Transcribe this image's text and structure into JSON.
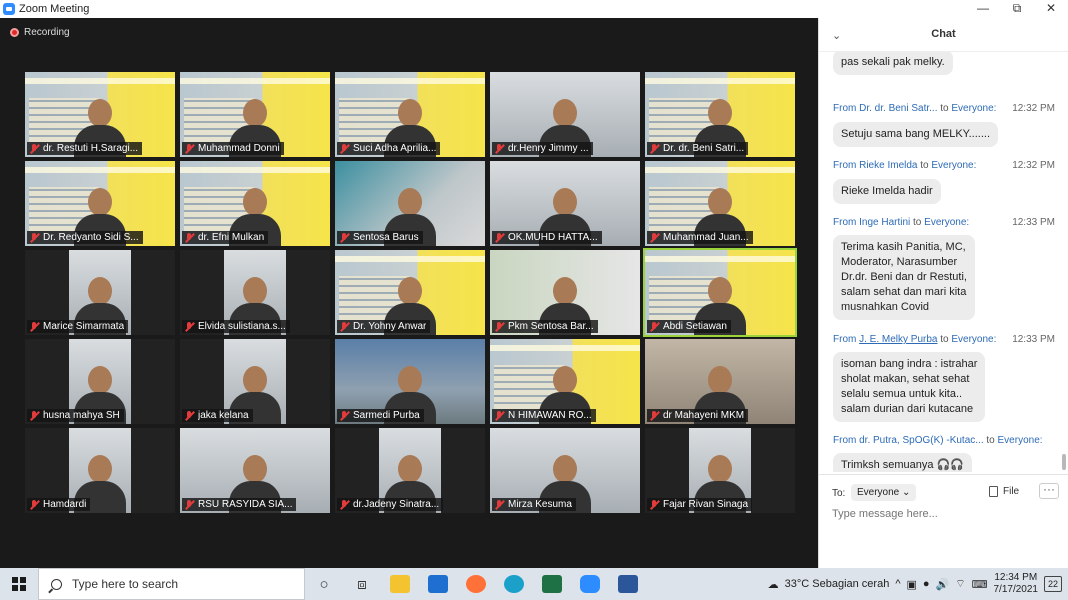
{
  "window": {
    "title": "Zoom Meeting",
    "minimize": "—",
    "maximize": "⧉",
    "close": "✕"
  },
  "recording": {
    "label": "Recording"
  },
  "colors": {
    "accent": "#2d8cff",
    "recording": "#e02828",
    "chat_name": "#2d6bb5",
    "active_speaker": "#9ad33a"
  },
  "participants": [
    {
      "name": "dr. Restuti H.Saragi..."
    },
    {
      "name": "Muhammad Donni"
    },
    {
      "name": "Suci Adha Aprilia..."
    },
    {
      "name": "dr.Henry Jimmy ..."
    },
    {
      "name": "Dr. dr. Beni Satri..."
    },
    {
      "name": "Dr. Redyanto Sidi S..."
    },
    {
      "name": "dr. Efni Mulkan"
    },
    {
      "name": "Sentosa Barus"
    },
    {
      "name": "OK.MUHD HATTA..."
    },
    {
      "name": "Muhammad Juan..."
    },
    {
      "name": "Marice Simarmata"
    },
    {
      "name": "Elvida sulistiana.s..."
    },
    {
      "name": "Dr. Yohny Anwar"
    },
    {
      "name": "Pkm Sentosa Bar..."
    },
    {
      "name": "Abdi Setiawan"
    },
    {
      "name": "husna mahya SH"
    },
    {
      "name": "jaka kelana"
    },
    {
      "name": "Sarmedi Purba"
    },
    {
      "name": "N HIMAWAN  RO..."
    },
    {
      "name": "dr Mahayeni MKM"
    },
    {
      "name": "Hamdardi"
    },
    {
      "name": "RSU RASYIDA SIA..."
    },
    {
      "name": "dr.Jadeny Sinatra..."
    },
    {
      "name": "Mirza Kesuma"
    },
    {
      "name": "Fajar Rivan Sinaga"
    }
  ],
  "chat": {
    "title": "Chat",
    "collapse_icon": "chevron-down-icon",
    "first_message": "pas sekali pak melky.",
    "messages": [
      {
        "from": "Dr. dr. Beni Satr...",
        "to_label": "to",
        "to": "Everyone:",
        "time": "12:32 PM",
        "text": "Setuju sama bang MELKY......."
      },
      {
        "from": "Rieke Imelda",
        "to_label": "to",
        "to": "Everyone:",
        "time": "12:32 PM",
        "text": "Rieke Imelda hadir"
      },
      {
        "from": "Inge Hartini",
        "to_label": "to",
        "to": "Everyone:",
        "time": "12:33 PM",
        "text": "Terima kasih Panitia, MC,\nModerator, Narasumber\nDr.dr. Beni dan dr Restuti,\nsalam sehat dan mari kita\nmusnahkan Covid"
      },
      {
        "from": "J. E. Melky Purba",
        "to_label": "to",
        "to": "Everyone:",
        "time": "12:33 PM",
        "text": "isoman bang indra : istrahar\nsholat makan, sehat sehat\nselalu semua untuk kita..\nsalam durian dari kutacane"
      },
      {
        "from": "dr. Putra, SpOG(K) -Kutac...",
        "to_label": "to",
        "to": "Everyone:",
        "time": "",
        "text": "Trimksh semuanya 🎧🎧"
      }
    ],
    "compose": {
      "to_label": "To:",
      "recipient": "Everyone",
      "file_label": "File",
      "more": "···",
      "placeholder": "Type message here..."
    }
  },
  "taskbar": {
    "search_placeholder": "Type here to search",
    "weather": "33°C  Sebagian cerah",
    "time": "12:34 PM",
    "date": "7/17/2021",
    "notifications": "22"
  }
}
